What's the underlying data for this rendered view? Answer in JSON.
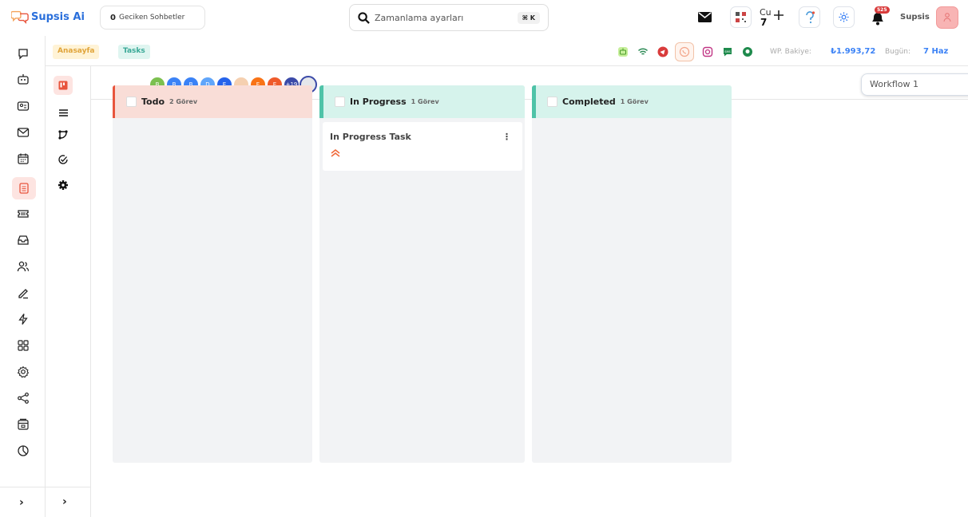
{
  "app": {
    "name": "Supsis Ai"
  },
  "header": {
    "late_chats_count": "0",
    "late_chats_label": "Geciken Sohbetler",
    "search_placeholder": "Zamanlama ayarları",
    "search_shortcut": "⌘ K",
    "calendar_day": "Cu",
    "calendar_date": "7",
    "notification_count": "525",
    "user_name": "Supsis"
  },
  "breadcrumb": {
    "home": "Anasayfa",
    "current": "Tasks"
  },
  "status_bar": {
    "wp_balance_label": "WP. Bakiye:",
    "wp_balance_value": "₺1.993,72",
    "today_label": "Bugün:",
    "today_value": "7 Haz"
  },
  "members": [
    {
      "initial": "B",
      "color": "#7cc04f"
    },
    {
      "initial": "B",
      "color": "#3b82f6"
    },
    {
      "initial": "B",
      "color": "#3b82f6"
    },
    {
      "initial": "D",
      "color": "#60a5fa"
    },
    {
      "initial": "E",
      "color": "#2563eb"
    },
    {
      "initial": "",
      "color": "#f5d0b0"
    },
    {
      "initial": "E",
      "color": "#f97316"
    },
    {
      "initial": "E",
      "color": "#ef5b2b"
    },
    {
      "initial": "+19",
      "color": "#3b4aa8"
    },
    {
      "initial": "",
      "color": "#e5e7eb"
    }
  ],
  "workflow_select": {
    "value": "Workflow 1"
  },
  "columns": [
    {
      "title": "Todo",
      "count": "2 Görev",
      "head_color": "#f9ddd7",
      "accent": "#e8553d"
    },
    {
      "title": "In Progress",
      "count": "1 Görev",
      "head_color": "#d6f3ec",
      "accent": "#4fc3a8"
    },
    {
      "title": "Completed",
      "count": "1 Görev",
      "head_color": "#d6f3ec",
      "accent": "#4fc3a8"
    }
  ],
  "task": {
    "title": "In Progress Task",
    "priority_color": "#f06a3b"
  },
  "sidebar_icons": [
    "chat-bubble-icon",
    "robot-icon",
    "contact-card-icon",
    "mail-icon",
    "calendar-icon",
    "tasks-icon",
    "ticket-icon",
    "inbox-icon",
    "users-icon",
    "edit-icon",
    "lightning-icon",
    "apps-grid-icon",
    "settings-icon",
    "share-icon",
    "billing-icon",
    "chart-icon"
  ],
  "inner_icons": [
    "kanban-icon",
    "list-icon",
    "workflow-icon",
    "check-circle-icon",
    "cog-icon"
  ]
}
